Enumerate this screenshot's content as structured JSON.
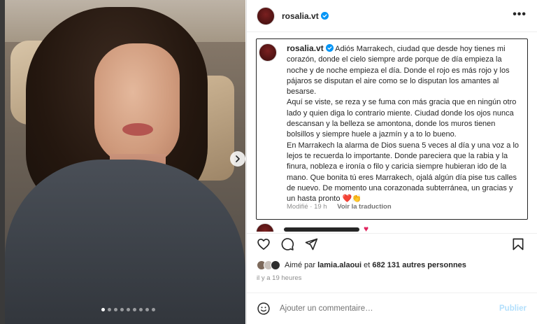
{
  "post": {
    "username": "rosalia.vt",
    "more_label": "•••",
    "carousel": {
      "total": 9,
      "current": 1
    }
  },
  "caption": {
    "username": "rosalia.vt",
    "text": "Adiós Marrakech, ciudad que desde hoy tienes mi corazón, donde el cielo siempre arde porque de día empieza la noche y de noche empieza el día. Donde el rojo es más rojo y los pájaros se disputan el aire como se lo disputan los amantes al besarse.\nAquí se viste, se reza y se fuma con más gracia que en ningún otro lado y quien diga lo contrario miente. Ciudad donde los ojos nunca descansan y la belleza se amontona, donde los muros tienen bolsillos y siempre huele a jazmín y a to lo bueno.\nEn Marrakech la alarma de Dios suena 5 veces al día y una voz a lo lejos te recuerda lo importante. Donde pareciera que la rabia y la finura, nobleza e ironía o filo y caricia siempre hubieran ido de la mano. Que bonita tú eres Marrakech, ojalá algún día pise tus calles de nuevo. De momento una corazonada subterránea, un gracias y un hasta pronto ❤️👏",
    "modified": "Modifié · 19 h",
    "translate": "Voir la traduction"
  },
  "likes": {
    "prefix": "Aimé par",
    "user": "lamia.alaoui",
    "connector": "et",
    "count": "682 131 autres personnes"
  },
  "timestamp": "il y a 19 heures",
  "comment": {
    "placeholder": "Ajouter un commentaire…",
    "post_label": "Publier"
  },
  "colors": {
    "verified": "#0095f6",
    "post_button_disabled": "#b2dffc",
    "heart": "#e0245e"
  },
  "icons": [
    "verified-badge-icon",
    "more-options-icon",
    "chevron-right-icon",
    "heart-icon",
    "comment-icon",
    "share-icon",
    "bookmark-icon",
    "emoji-icon"
  ]
}
